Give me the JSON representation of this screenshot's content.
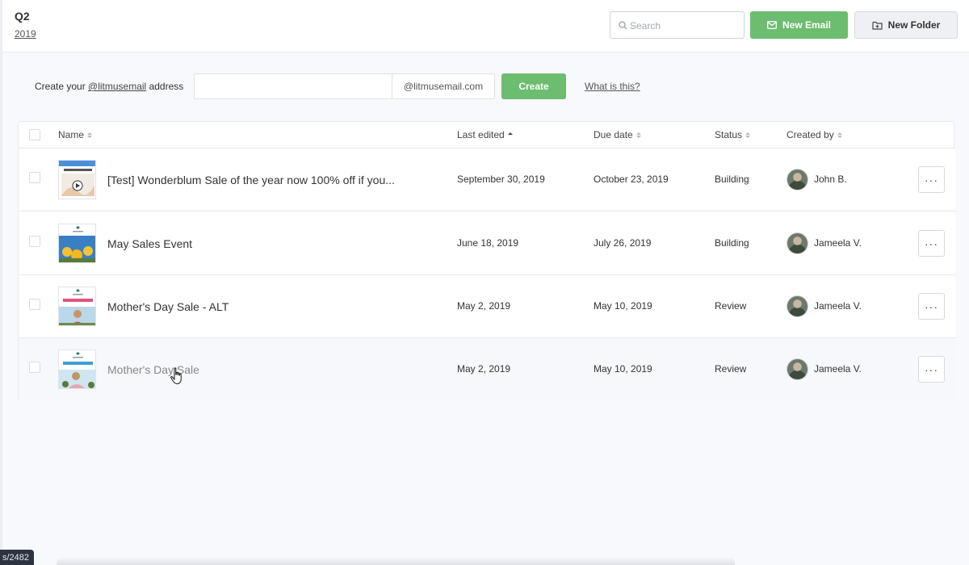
{
  "header": {
    "folder_title": "Q2",
    "folder_subtitle": "2019",
    "search_placeholder": "Search",
    "new_email_label": "New Email",
    "new_folder_label": "New Folder"
  },
  "create_address": {
    "prefix": "Create your ",
    "link": "@litmusemail",
    "suffix_text": " address",
    "input_value": "",
    "domain_suffix": "@litmusemail.com",
    "create_label": "Create",
    "help_link": "What is this?"
  },
  "table": {
    "columns": {
      "name": "Name",
      "last_edited": "Last edited",
      "due_date": "Due date",
      "status": "Status",
      "created_by": "Created by"
    },
    "rows": [
      {
        "name": "[Test] Wonderblum Sale of the year now 100% off if you...",
        "last_edited": "September 30, 2019",
        "due_date": "October 23, 2019",
        "status": "Building",
        "created_by": "John B."
      },
      {
        "name": "May Sales Event",
        "last_edited": "June 18, 2019",
        "due_date": "July 26, 2019",
        "status": "Building",
        "created_by": "Jameela V."
      },
      {
        "name": "Mother's Day Sale - ALT",
        "last_edited": "May 2, 2019",
        "due_date": "May 10, 2019",
        "status": "Review",
        "created_by": "Jameela V."
      },
      {
        "name": "Mother's Day Sale",
        "last_edited": "May 2, 2019",
        "due_date": "May 10, 2019",
        "status": "Review",
        "created_by": "Jameela V."
      }
    ],
    "more_label": "···"
  },
  "status_bar": {
    "text": "s/2482"
  },
  "colors": {
    "accent_green": "#6cbd6f",
    "background": "#f8f9fc"
  }
}
